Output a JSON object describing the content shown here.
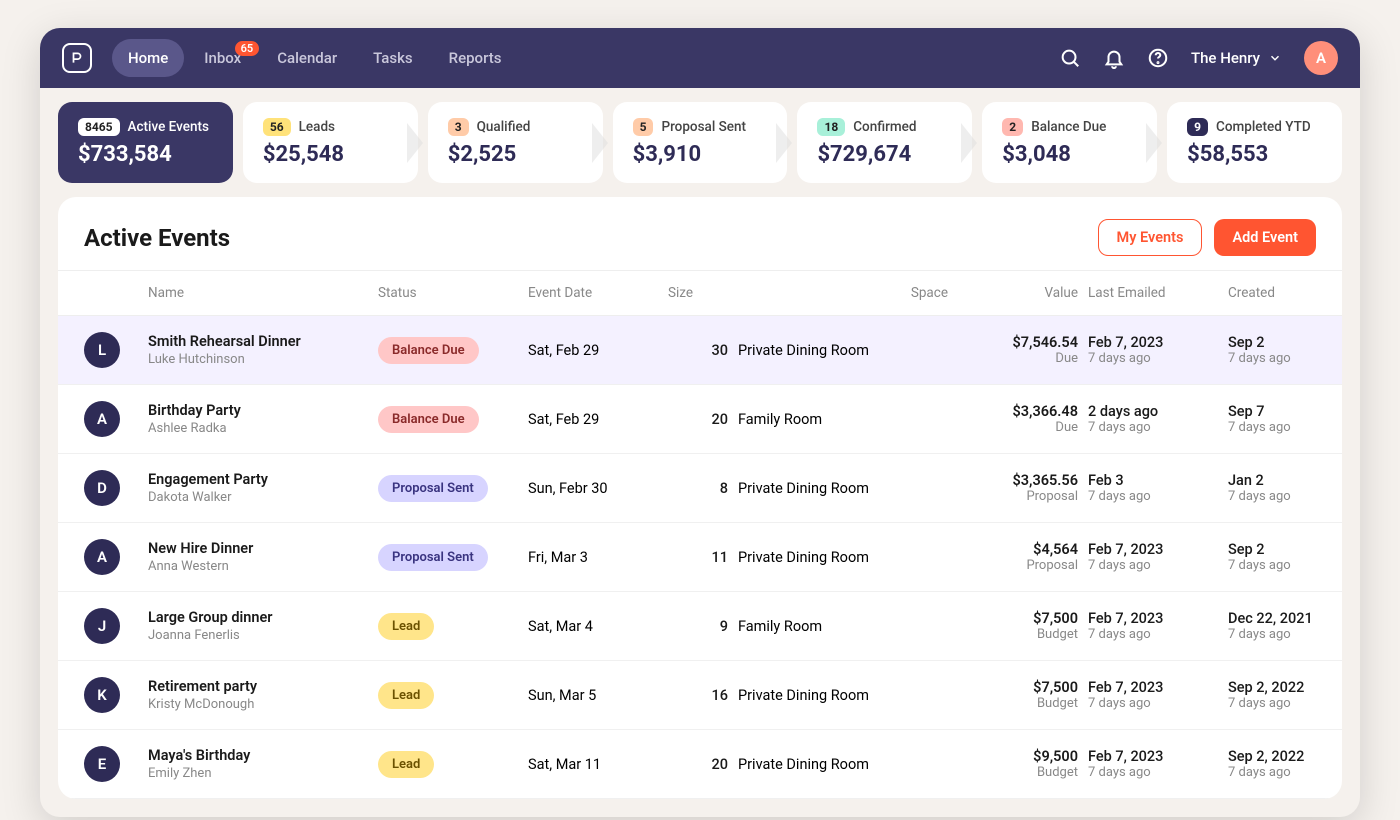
{
  "nav": {
    "items": [
      "Home",
      "Inbox",
      "Calendar",
      "Tasks",
      "Reports"
    ],
    "inbox_badge": "65"
  },
  "org_name": "The Henry",
  "avatar_letter": "A",
  "pipeline": [
    {
      "count": "8465",
      "label": "Active Events",
      "amount": "$733,584",
      "pill": ""
    },
    {
      "count": "56",
      "label": "Leads",
      "amount": "$25,548",
      "pill": "pill-yellow"
    },
    {
      "count": "3",
      "label": "Qualified",
      "amount": "$2,525",
      "pill": "pill-orange"
    },
    {
      "count": "5",
      "label": "Proposal Sent",
      "amount": "$3,910",
      "pill": "pill-orange"
    },
    {
      "count": "18",
      "label": "Confirmed",
      "amount": "$729,674",
      "pill": "pill-teal"
    },
    {
      "count": "2",
      "label": "Balance Due",
      "amount": "$3,048",
      "pill": "pill-red"
    },
    {
      "count": "9",
      "label": "Completed YTD",
      "amount": "$58,553",
      "pill": "pill-navy"
    }
  ],
  "panel_title": "Active Events",
  "buttons": {
    "my_events": "My Events",
    "add_event": "Add Event"
  },
  "columns": [
    "",
    "Name",
    "Status",
    "Event Date",
    "Size",
    "Space",
    "Value",
    "Last Emailed",
    "Created",
    ""
  ],
  "rows": [
    {
      "hl": true,
      "letter": "L",
      "title": "Smith Rehearsal Dinner",
      "person": "Luke Hutchinson",
      "status": "Balance Due",
      "sclass": "sp-red",
      "date": "Sat, Feb 29",
      "size": "30",
      "space": "Private Dining Room",
      "v1": "$7,546.54",
      "v2": "Due",
      "e1": "Feb 7, 2023",
      "e2": "7 days ago",
      "c1": "Sep 2",
      "c2": "7 days ago"
    },
    {
      "letter": "A",
      "title": "Birthday Party",
      "person": "Ashlee Radka",
      "status": "Balance Due",
      "sclass": "sp-red",
      "date": "Sat, Feb 29",
      "size": "20",
      "space": "Family Room",
      "v1": "$3,366.48",
      "v2": "Due",
      "e1": "2 days ago",
      "e2": "7 days ago",
      "c1": "Sep 7",
      "c2": "7 days ago"
    },
    {
      "letter": "D",
      "title": "Engagement Party",
      "person": "Dakota Walker",
      "status": "Proposal Sent",
      "sclass": "sp-purple",
      "date": "Sun, Febr 30",
      "size": "8",
      "space": "Private Dining Room",
      "v1": "$3,365.56",
      "v2": "Proposal",
      "e1": "Feb 3",
      "e2": "7 days ago",
      "c1": "Jan 2",
      "c2": "7 days ago"
    },
    {
      "letter": "A",
      "title": "New Hire Dinner",
      "person": "Anna Western",
      "status": "Proposal Sent",
      "sclass": "sp-purple",
      "date": "Fri, Mar 3",
      "size": "11",
      "space": "Private Dining Room",
      "v1": "$4,564",
      "v2": "Proposal",
      "e1": "Feb 7, 2023",
      "e2": "7 days ago",
      "c1": "Sep 2",
      "c2": "7 days ago"
    },
    {
      "letter": "J",
      "title": "Large Group dinner",
      "person": "Joanna Fenerlis",
      "status": "Lead",
      "sclass": "sp-yellow",
      "date": "Sat, Mar 4",
      "size": "9",
      "space": "Family Room",
      "v1": "$7,500",
      "v2": "Budget",
      "e1": "Feb 7, 2023",
      "e2": "7 days ago",
      "c1": "Dec 22, 2021",
      "c2": "7 days ago"
    },
    {
      "letter": "K",
      "title": "Retirement party",
      "person": "Kristy McDonough",
      "status": "Lead",
      "sclass": "sp-yellow",
      "date": "Sun, Mar 5",
      "size": "16",
      "space": "Private Dining Room",
      "v1": "$7,500",
      "v2": "Budget",
      "e1": "Feb 7, 2023",
      "e2": "7 days ago",
      "c1": "Sep 2, 2022",
      "c2": "7 days ago"
    },
    {
      "letter": "E",
      "title": "Maya's Birthday",
      "person": "Emily Zhen",
      "status": "Lead",
      "sclass": "sp-yellow",
      "date": "Sat, Mar 11",
      "size": "20",
      "space": "Private Dining Room",
      "v1": "$9,500",
      "v2": "Budget",
      "e1": "Feb 7, 2023",
      "e2": "7 days ago",
      "c1": "Sep 2, 2022",
      "c2": "7 days ago"
    }
  ]
}
